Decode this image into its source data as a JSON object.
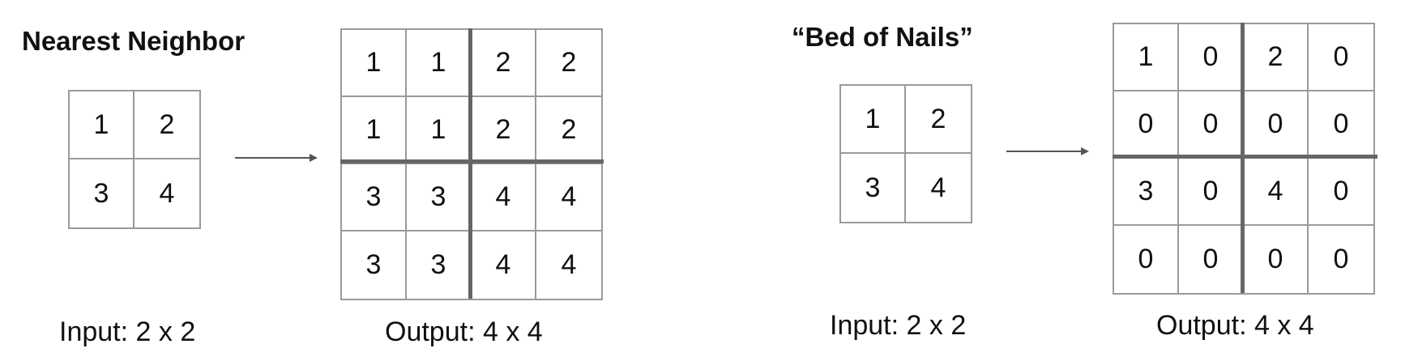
{
  "panels": [
    {
      "title": "Nearest Neighbor",
      "input_label": "Input: 2 x 2",
      "output_label": "Output: 4 x 4",
      "input": [
        "1",
        "2",
        "3",
        "4"
      ],
      "output": [
        "1",
        "1",
        "2",
        "2",
        "1",
        "1",
        "2",
        "2",
        "3",
        "3",
        "4",
        "4",
        "3",
        "3",
        "4",
        "4"
      ]
    },
    {
      "title": "“Bed of Nails”",
      "input_label": "Input: 2 x 2",
      "output_label": "Output: 4 x 4",
      "input": [
        "1",
        "2",
        "3",
        "4"
      ],
      "output": [
        "1",
        "0",
        "2",
        "0",
        "0",
        "0",
        "0",
        "0",
        "3",
        "0",
        "4",
        "0",
        "0",
        "0",
        "0",
        "0"
      ]
    }
  ]
}
